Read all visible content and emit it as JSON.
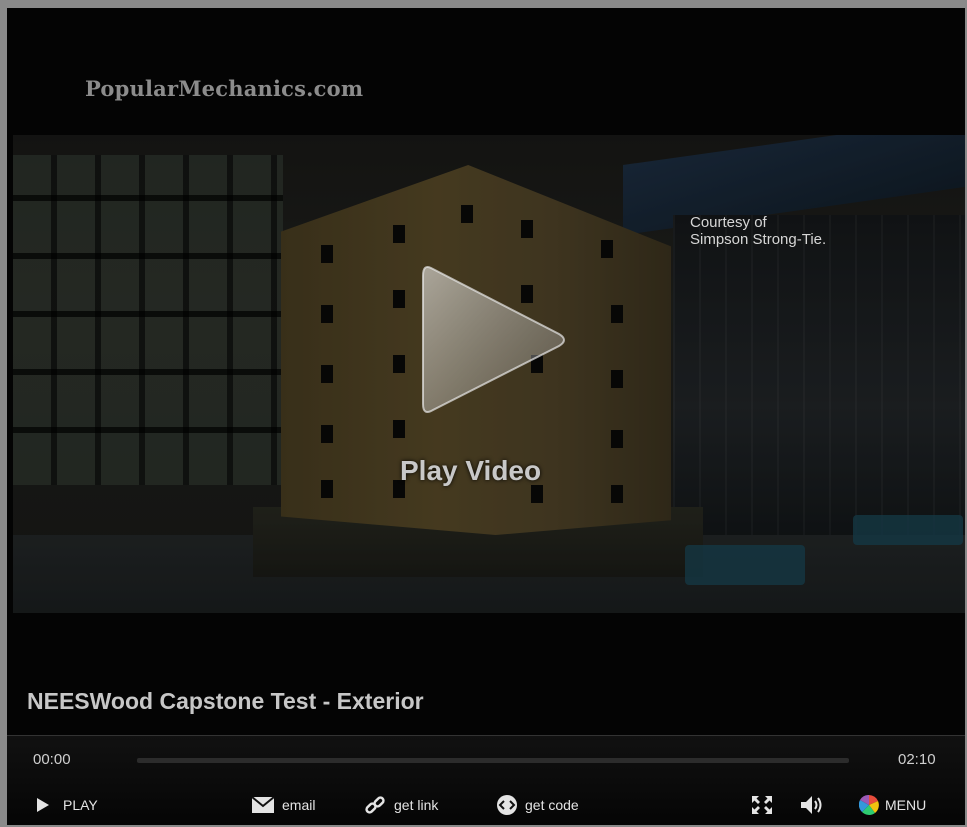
{
  "brand": "PopularMechanics.com",
  "overlay": {
    "courtesy_line1": "Courtesy of",
    "courtesy_line2": "Simpson Strong-Tie.",
    "play_label": "Play Video"
  },
  "video": {
    "title": "NEESWood Capstone Test - Exterior",
    "current_time": "00:00",
    "duration": "02:10",
    "progress": 0
  },
  "controls": {
    "play_label": "PLAY",
    "email_label": "email",
    "link_label": "get link",
    "code_label": "get code",
    "menu_label": "MENU"
  },
  "icons": {
    "play": "play-icon",
    "email": "envelope-icon",
    "link": "link-icon",
    "code": "code-icon",
    "fullscreen": "fullscreen-icon",
    "volume": "volume-icon",
    "menu": "menu-icon"
  },
  "colors": {
    "player_bg": "#000000",
    "text": "#d0d0d0",
    "frame": "#8a8a8a"
  }
}
